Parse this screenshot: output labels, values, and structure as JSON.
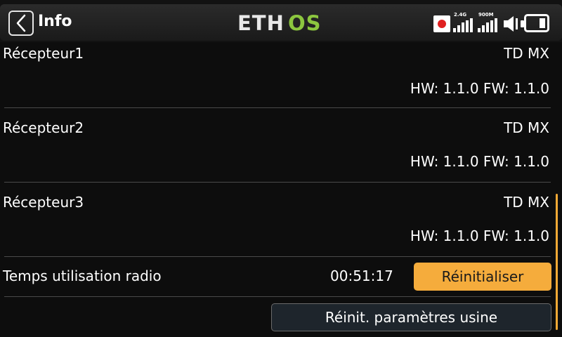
{
  "header": {
    "title": "Info",
    "logo_text": "ETHOS",
    "signal1_label": "2.4G",
    "signal2_label": "900M"
  },
  "receivers": [
    {
      "label": "Récepteur1",
      "model": "TD MX",
      "version": "HW: 1.1.0 FW: 1.1.0"
    },
    {
      "label": "Récepteur2",
      "model": "TD MX",
      "version": "HW: 1.1.0 FW: 1.1.0"
    },
    {
      "label": "Récepteur3",
      "model": "TD MX",
      "version": "HW: 1.1.0 FW: 1.1.0"
    }
  ],
  "radio_time": {
    "label": "Temps utilisation radio",
    "value": "00:51:17",
    "reset_label": "Réinitialiser"
  },
  "factory_reset_label": "Réinit. paramètres usine",
  "colors": {
    "accent": "#f5ac3c",
    "logo_green": "#8cc63f",
    "record": "#e02020"
  }
}
